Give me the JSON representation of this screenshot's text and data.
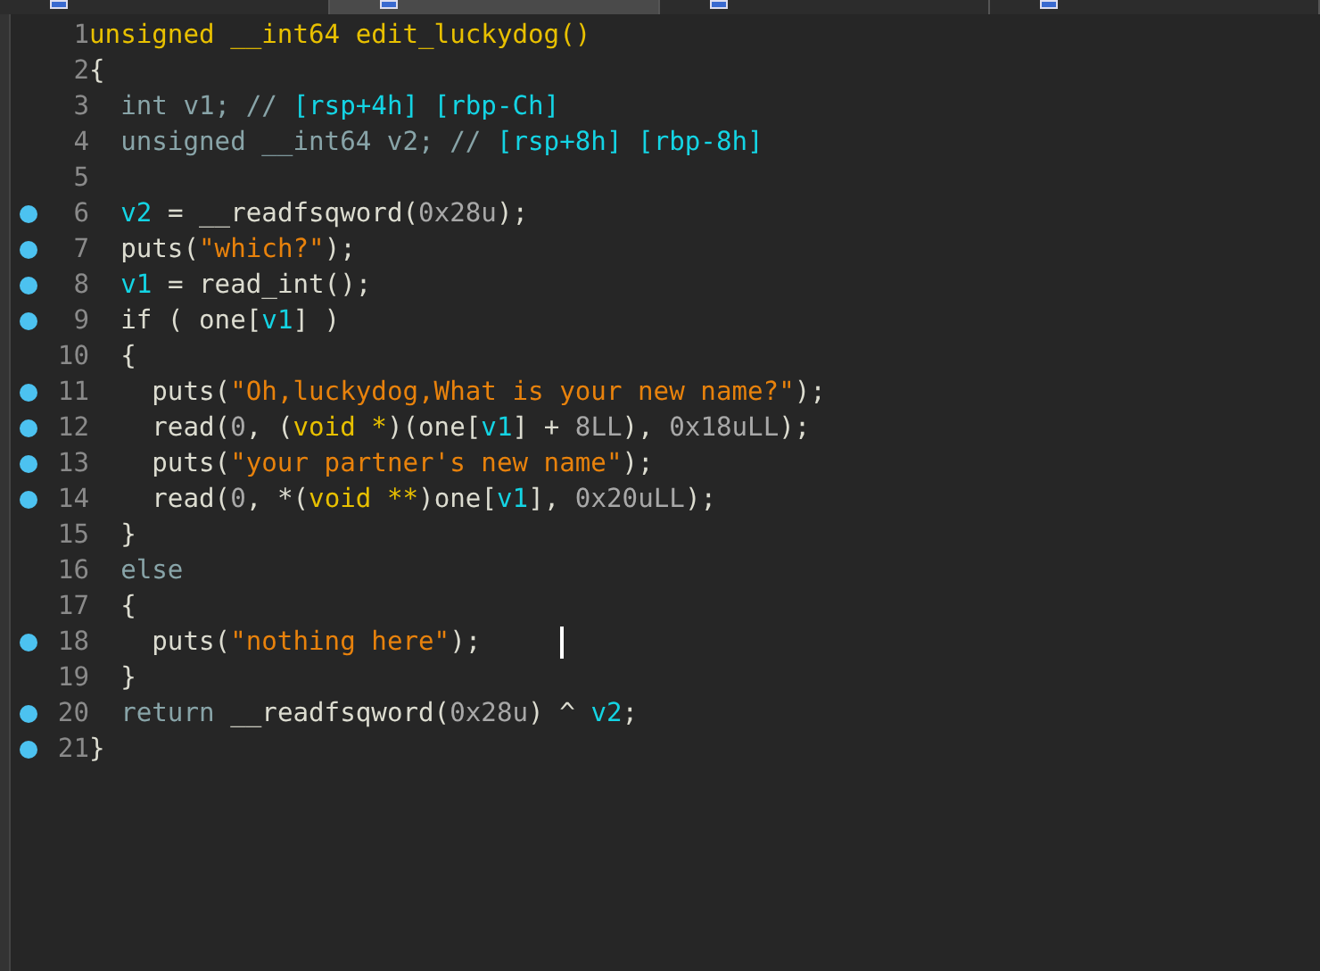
{
  "tabs": [
    {
      "selected": false
    },
    {
      "selected": true
    },
    {
      "selected": false
    },
    {
      "selected": false
    }
  ],
  "code_lines": [
    {
      "number": "1",
      "breakpoint": false,
      "tokens": [
        {
          "kind": "signature",
          "text": "unsigned __int64 edit_luckydog()"
        }
      ]
    },
    {
      "number": "2",
      "breakpoint": false,
      "tokens": [
        {
          "kind": "plain",
          "text": "{"
        }
      ]
    },
    {
      "number": "3",
      "breakpoint": false,
      "tokens": [
        {
          "kind": "decl",
          "text": "  int v1; // "
        },
        {
          "kind": "var",
          "text": "[rsp+4h] [rbp-Ch]"
        }
      ]
    },
    {
      "number": "4",
      "breakpoint": false,
      "tokens": [
        {
          "kind": "decl",
          "text": "  unsigned __int64 v2; // "
        },
        {
          "kind": "var",
          "text": "[rsp+8h] [rbp-8h]"
        }
      ]
    },
    {
      "number": "5",
      "breakpoint": false
    },
    {
      "number": "6",
      "breakpoint": true,
      "tokens": [
        {
          "kind": "var",
          "text": "  v2"
        },
        {
          "kind": "plain",
          "text": " = __readfsqword("
        },
        {
          "kind": "number",
          "text": "0x28u"
        },
        {
          "kind": "plain",
          "text": ");"
        }
      ]
    },
    {
      "number": "7",
      "breakpoint": true,
      "tokens": [
        {
          "kind": "plain",
          "text": "  puts("
        },
        {
          "kind": "string",
          "text": "\"which?\""
        },
        {
          "kind": "plain",
          "text": ");"
        }
      ]
    },
    {
      "number": "8",
      "breakpoint": true,
      "tokens": [
        {
          "kind": "var",
          "text": "  v1"
        },
        {
          "kind": "plain",
          "text": " = read_int();"
        }
      ]
    },
    {
      "number": "9",
      "breakpoint": true,
      "tokens": [
        {
          "kind": "plain",
          "text": "  if ( one["
        },
        {
          "kind": "var",
          "text": "v1"
        },
        {
          "kind": "plain",
          "text": "] )"
        }
      ]
    },
    {
      "number": "10",
      "breakpoint": false,
      "tokens": [
        {
          "kind": "plain",
          "text": "  {"
        }
      ]
    },
    {
      "number": "11",
      "breakpoint": true,
      "tokens": [
        {
          "kind": "plain",
          "text": "    puts("
        },
        {
          "kind": "string",
          "text": "\"Oh,luckydog,What is your new name?\""
        },
        {
          "kind": "plain",
          "text": ");"
        }
      ]
    },
    {
      "number": "12",
      "breakpoint": true,
      "tokens": [
        {
          "kind": "plain",
          "text": "    read("
        },
        {
          "kind": "number",
          "text": "0"
        },
        {
          "kind": "plain",
          "text": ", ("
        },
        {
          "kind": "type",
          "text": "void *"
        },
        {
          "kind": "plain",
          "text": ")(one["
        },
        {
          "kind": "var",
          "text": "v1"
        },
        {
          "kind": "plain",
          "text": "] + "
        },
        {
          "kind": "number",
          "text": "8LL"
        },
        {
          "kind": "plain",
          "text": "), "
        },
        {
          "kind": "number",
          "text": "0x18uLL"
        },
        {
          "kind": "plain",
          "text": ");"
        }
      ]
    },
    {
      "number": "13",
      "breakpoint": true,
      "tokens": [
        {
          "kind": "plain",
          "text": "    puts("
        },
        {
          "kind": "string",
          "text": "\"your partner's new name\""
        },
        {
          "kind": "plain",
          "text": ");"
        }
      ]
    },
    {
      "number": "14",
      "breakpoint": true,
      "tokens": [
        {
          "kind": "plain",
          "text": "    read("
        },
        {
          "kind": "number",
          "text": "0"
        },
        {
          "kind": "plain",
          "text": ", *("
        },
        {
          "kind": "type",
          "text": "void **"
        },
        {
          "kind": "plain",
          "text": ")one["
        },
        {
          "kind": "var",
          "text": "v1"
        },
        {
          "kind": "plain",
          "text": "], "
        },
        {
          "kind": "number",
          "text": "0x20uLL"
        },
        {
          "kind": "plain",
          "text": ");"
        }
      ]
    },
    {
      "number": "15",
      "breakpoint": false,
      "tokens": [
        {
          "kind": "plain",
          "text": "  }"
        }
      ]
    },
    {
      "number": "16",
      "breakpoint": false,
      "tokens": [
        {
          "kind": "decl",
          "text": "  else"
        }
      ]
    },
    {
      "number": "17",
      "breakpoint": false,
      "tokens": [
        {
          "kind": "plain",
          "text": "  {"
        }
      ]
    },
    {
      "number": "18",
      "breakpoint": true,
      "tokens": [
        {
          "kind": "plain",
          "text": "    puts("
        },
        {
          "kind": "string",
          "text": "\"nothing here\""
        },
        {
          "kind": "plain",
          "text": ");"
        }
      ]
    },
    {
      "number": "19",
      "breakpoint": false,
      "tokens": [
        {
          "kind": "plain",
          "text": "  }"
        }
      ]
    },
    {
      "number": "20",
      "breakpoint": true,
      "tokens": [
        {
          "kind": "decl",
          "text": "  return"
        },
        {
          "kind": "plain",
          "text": " __readfsqword("
        },
        {
          "kind": "number",
          "text": "0x28u"
        },
        {
          "kind": "plain",
          "text": ") ^ "
        },
        {
          "kind": "var",
          "text": "v2"
        },
        {
          "kind": "plain",
          "text": ";"
        }
      ]
    },
    {
      "number": "21",
      "breakpoint": true,
      "tokens": [
        {
          "kind": "plain",
          "text": "}"
        }
      ]
    }
  ]
}
